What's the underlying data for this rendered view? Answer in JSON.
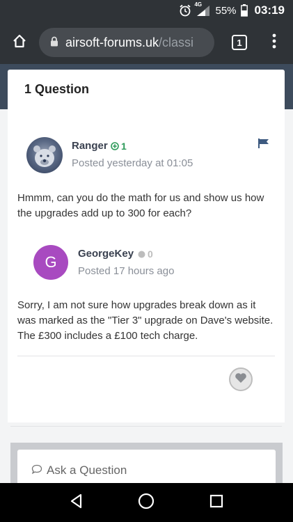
{
  "status_bar": {
    "network": "4G",
    "battery": "55%",
    "time": "03:19"
  },
  "browser": {
    "url_host": "airsoft-forums.uk",
    "url_path": "/classi",
    "tab_count": "1"
  },
  "question": {
    "title": "1 Question"
  },
  "posts": [
    {
      "author": "Ranger",
      "reputation": "1",
      "posted": "Posted yesterday at 01:05",
      "text": "Hmmm,  can you do the math for us and show us how the upgrades add up to 300 for each?"
    },
    {
      "author": "GeorgeKey",
      "avatar_letter": "G",
      "reputation": "0",
      "posted": "Posted 17 hours ago",
      "text": "Sorry, I am not sure how upgrades break down as it was marked as the \"Tier 3\" upgrade on Dave's website. The £300 includes a £100 tech charge."
    }
  ],
  "reply": {
    "label": "Ask a Question"
  },
  "colors": {
    "chrome_bg": "#2f3337",
    "header_band": "#3d4b5c",
    "rep_positive": "#2e9a5a",
    "rep_neutral": "#bdbdbd",
    "avatar_g": "#a84ac0",
    "flag": "#3d5a80"
  }
}
